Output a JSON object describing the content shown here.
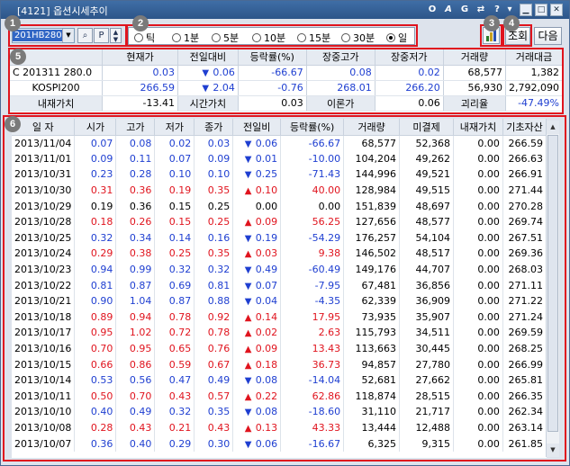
{
  "window": {
    "title": "[4121] 옵션시세추이",
    "toolbar_icons": [
      "O",
      "A",
      "G",
      "⇄",
      "?",
      "▾"
    ]
  },
  "annotations": [
    "1",
    "2",
    "3",
    "4",
    "5",
    "6"
  ],
  "code_select": {
    "value": "201HB280"
  },
  "period": {
    "options": [
      "틱",
      "1분",
      "5분",
      "10분",
      "15분",
      "30분",
      "일"
    ],
    "selected": "일"
  },
  "buttons": {
    "query": "조회",
    "next": "다음"
  },
  "summary": {
    "headers": [
      "현재가",
      "전일대비",
      "등락률(%)",
      "장중고가",
      "장중저가",
      "거래량",
      "거래대금"
    ],
    "rows": [
      {
        "label": "C 201311 280.0",
        "cur": "0.03",
        "arrow": "down",
        "chg": "0.06",
        "rate": "-66.67",
        "high": "0.08",
        "low": "0.02",
        "vol": "68,577",
        "amt": "1,382"
      },
      {
        "label": "KOSPI200",
        "cur": "266.59",
        "arrow": "down",
        "chg": "2.04",
        "rate": "-0.76",
        "high": "268.01",
        "low": "266.20",
        "vol": "56,930",
        "amt": "2,792,090"
      }
    ],
    "extra": {
      "intrinsic_label": "내재가치",
      "intrinsic_val": "-13.41",
      "time_label": "시간가치",
      "time_val": "0.03",
      "theory_label": "이론가",
      "theory_val": "0.06",
      "deviation_label": "괴리율",
      "deviation_val": "-47.49%"
    }
  },
  "grid": {
    "headers": [
      "일  자",
      "시가",
      "고가",
      "저가",
      "종가",
      "전일비",
      "등락률(%)",
      "거래량",
      "미결제",
      "내재가치",
      "기초자산"
    ],
    "rows": [
      [
        "2013/11/04",
        "0.07",
        "0.08",
        "0.02",
        "0.03",
        "down",
        "0.06",
        "-66.67",
        "68,577",
        "52,368",
        "0.00",
        "266.59"
      ],
      [
        "2013/11/01",
        "0.09",
        "0.11",
        "0.07",
        "0.09",
        "down",
        "0.01",
        "-10.00",
        "104,204",
        "49,262",
        "0.00",
        "266.63"
      ],
      [
        "2013/10/31",
        "0.23",
        "0.28",
        "0.10",
        "0.10",
        "down",
        "0.25",
        "-71.43",
        "144,996",
        "49,521",
        "0.00",
        "266.91"
      ],
      [
        "2013/10/30",
        "0.31",
        "0.36",
        "0.19",
        "0.35",
        "up",
        "0.10",
        "40.00",
        "128,984",
        "49,515",
        "0.00",
        "271.44"
      ],
      [
        "2013/10/29",
        "0.19",
        "0.36",
        "0.15",
        "0.25",
        "flat",
        "0.00",
        "0.00",
        "151,839",
        "48,697",
        "0.00",
        "270.28"
      ],
      [
        "2013/10/28",
        "0.18",
        "0.26",
        "0.15",
        "0.25",
        "up",
        "0.09",
        "56.25",
        "127,656",
        "48,577",
        "0.00",
        "269.74"
      ],
      [
        "2013/10/25",
        "0.32",
        "0.34",
        "0.14",
        "0.16",
        "down",
        "0.19",
        "-54.29",
        "176,257",
        "54,104",
        "0.00",
        "267.51"
      ],
      [
        "2013/10/24",
        "0.29",
        "0.38",
        "0.25",
        "0.35",
        "up",
        "0.03",
        "9.38",
        "146,502",
        "48,517",
        "0.00",
        "269.36"
      ],
      [
        "2013/10/23",
        "0.94",
        "0.99",
        "0.32",
        "0.32",
        "down",
        "0.49",
        "-60.49",
        "149,176",
        "44,707",
        "0.00",
        "268.03"
      ],
      [
        "2013/10/22",
        "0.81",
        "0.87",
        "0.69",
        "0.81",
        "down",
        "0.07",
        "-7.95",
        "67,481",
        "36,856",
        "0.00",
        "271.11"
      ],
      [
        "2013/10/21",
        "0.90",
        "1.04",
        "0.87",
        "0.88",
        "down",
        "0.04",
        "-4.35",
        "62,339",
        "36,909",
        "0.00",
        "271.22"
      ],
      [
        "2013/10/18",
        "0.89",
        "0.94",
        "0.78",
        "0.92",
        "up",
        "0.14",
        "17.95",
        "73,935",
        "35,907",
        "0.00",
        "271.24"
      ],
      [
        "2013/10/17",
        "0.95",
        "1.02",
        "0.72",
        "0.78",
        "up",
        "0.02",
        "2.63",
        "115,793",
        "34,511",
        "0.00",
        "269.59"
      ],
      [
        "2013/10/16",
        "0.70",
        "0.95",
        "0.65",
        "0.76",
        "up",
        "0.09",
        "13.43",
        "113,663",
        "30,445",
        "0.00",
        "268.25"
      ],
      [
        "2013/10/15",
        "0.66",
        "0.86",
        "0.59",
        "0.67",
        "up",
        "0.18",
        "36.73",
        "94,857",
        "27,780",
        "0.00",
        "266.99"
      ],
      [
        "2013/10/14",
        "0.53",
        "0.56",
        "0.47",
        "0.49",
        "down",
        "0.08",
        "-14.04",
        "52,681",
        "27,662",
        "0.00",
        "265.81"
      ],
      [
        "2013/10/11",
        "0.50",
        "0.70",
        "0.43",
        "0.57",
        "up",
        "0.22",
        "62.86",
        "118,874",
        "28,515",
        "0.00",
        "266.35"
      ],
      [
        "2013/10/10",
        "0.40",
        "0.49",
        "0.32",
        "0.35",
        "down",
        "0.08",
        "-18.60",
        "31,110",
        "21,717",
        "0.00",
        "262.34"
      ],
      [
        "2013/10/08",
        "0.28",
        "0.43",
        "0.21",
        "0.43",
        "up",
        "0.13",
        "43.33",
        "13,444",
        "12,488",
        "0.00",
        "263.14"
      ],
      [
        "2013/10/07",
        "0.36",
        "0.40",
        "0.29",
        "0.30",
        "down",
        "0.06",
        "-16.67",
        "6,325",
        "9,315",
        "0.00",
        "261.85"
      ]
    ]
  }
}
